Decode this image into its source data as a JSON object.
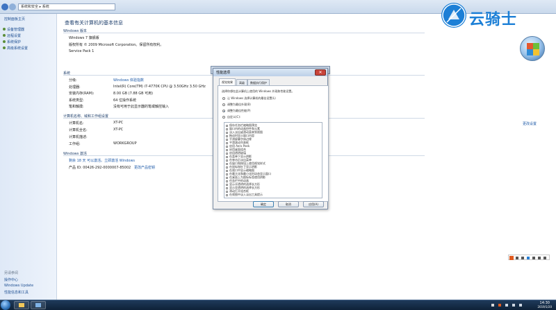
{
  "address": {
    "path": "系统和安全 ▸ 系统"
  },
  "sidebar": {
    "home": "控制面板主页",
    "items": [
      {
        "label": "设备管理器"
      },
      {
        "label": "远程设置"
      },
      {
        "label": "系统保护"
      },
      {
        "label": "高级系统设置"
      }
    ],
    "see_also_heading": "另请参阅",
    "see_also": [
      {
        "label": "操作中心"
      },
      {
        "label": "Windows Update"
      },
      {
        "label": "性能信息和工具"
      }
    ]
  },
  "main": {
    "heading": "查看有关计算机的基本信息",
    "edition_section": "Windows 版本",
    "edition_name": "Windows 7 旗舰版",
    "copyright": "版权所有 © 2009 Microsoft Corporation。保留所有权利。",
    "service_pack": "Service Pack 1",
    "system_section": "系统",
    "rating_label": "分级:",
    "rating_value": "Windows 体验指数",
    "processor_label": "处理器:",
    "processor_value": "Intel(R) Core(TM) i7-4770K CPU @ 3.50GHz   3.50 GHz",
    "ram_label": "安装内存(RAM):",
    "ram_value": "8.00 GB (7.88 GB 可用)",
    "systype_label": "系统类型:",
    "systype_value": "64 位操作系统",
    "pen_label": "笔和触摸:",
    "pen_value": "没有可用于此显示器的笔或触控输入",
    "name_section": "计算机名称、域和工作组设置",
    "pc_name_label": "计算机名:",
    "pc_name_value": "XT-PC",
    "full_name_label": "计算机全名:",
    "full_name_value": "XT-PC",
    "desc_label": "计算机描述:",
    "workgroup_label": "工作组:",
    "workgroup_value": "WORKGROUP",
    "change_settings": "更改设置",
    "activation_section": "Windows 激活",
    "activation_days": "剩余 18 天 可以激活。立即激活 Windows",
    "product_id": "产品 ID: 00426-292-0000007-85002",
    "change_key": "更改产品密钥"
  },
  "logo": {
    "text": "云骑士"
  },
  "dialog": {
    "title": "性能选项",
    "back_title": "系统属性",
    "tabs": [
      {
        "label": "视觉效果"
      },
      {
        "label": "高级"
      },
      {
        "label": "数据执行保护"
      }
    ],
    "intro": "选择你想在此计算机上使用的 Windows 外观和性能设置。",
    "radios": [
      {
        "label": "让 Windows 选择计算机的最佳设置(L)",
        "selected": false
      },
      {
        "label": "调整为最佳外观(B)",
        "selected": false
      },
      {
        "label": "调整为最佳性能(P)",
        "selected": true
      },
      {
        "label": "自定义(C):",
        "selected": false
      }
    ],
    "effects": [
      {
        "label": "保存任务栏缩略图预览"
      },
      {
        "label": "窗口内的动画控件和元素"
      },
      {
        "label": "淡入淡出或滑动菜单到视图"
      },
      {
        "label": "拖动时显示窗口内容"
      },
      {
        "label": "平滑屏幕字体边缘"
      },
      {
        "label": "平滑滚动列表框"
      },
      {
        "label": "启用 Aero Peek"
      },
      {
        "label": "启用桌面组合"
      },
      {
        "label": "启用透明玻璃"
      },
      {
        "label": "在菜单下显示阴影"
      },
      {
        "label": "在单击后淡出菜单"
      },
      {
        "label": "在窗口和按钮上使用视觉样式"
      },
      {
        "label": "在鼠标指针下显示阴影"
      },
      {
        "label": "在视口中显示缩略图"
      },
      {
        "label": "在最大化和最小化时动态显示窗口"
      },
      {
        "label": "在桌面上为图标标签使用阴影"
      },
      {
        "label": "任务栏中的动画"
      },
      {
        "label": "显示半透明的选择长方形"
      },
      {
        "label": "显示亚透明的选择长方形"
      },
      {
        "label": "滑动打开组合框"
      },
      {
        "label": "在视图中淡入淡出工具提示"
      },
      {
        "label": "在最大化时保存预览"
      },
      {
        "label": "在桌面上为图标标签使用阴影"
      }
    ],
    "ok": "确定",
    "cancel": "取消",
    "apply": "应用(A)"
  },
  "taskbar": {
    "time": "14:30",
    "date": "2019/1/20"
  },
  "colors": {
    "link": "#1e5aa8",
    "brand": "#1c7fd6",
    "taskbar": "#12283f"
  }
}
